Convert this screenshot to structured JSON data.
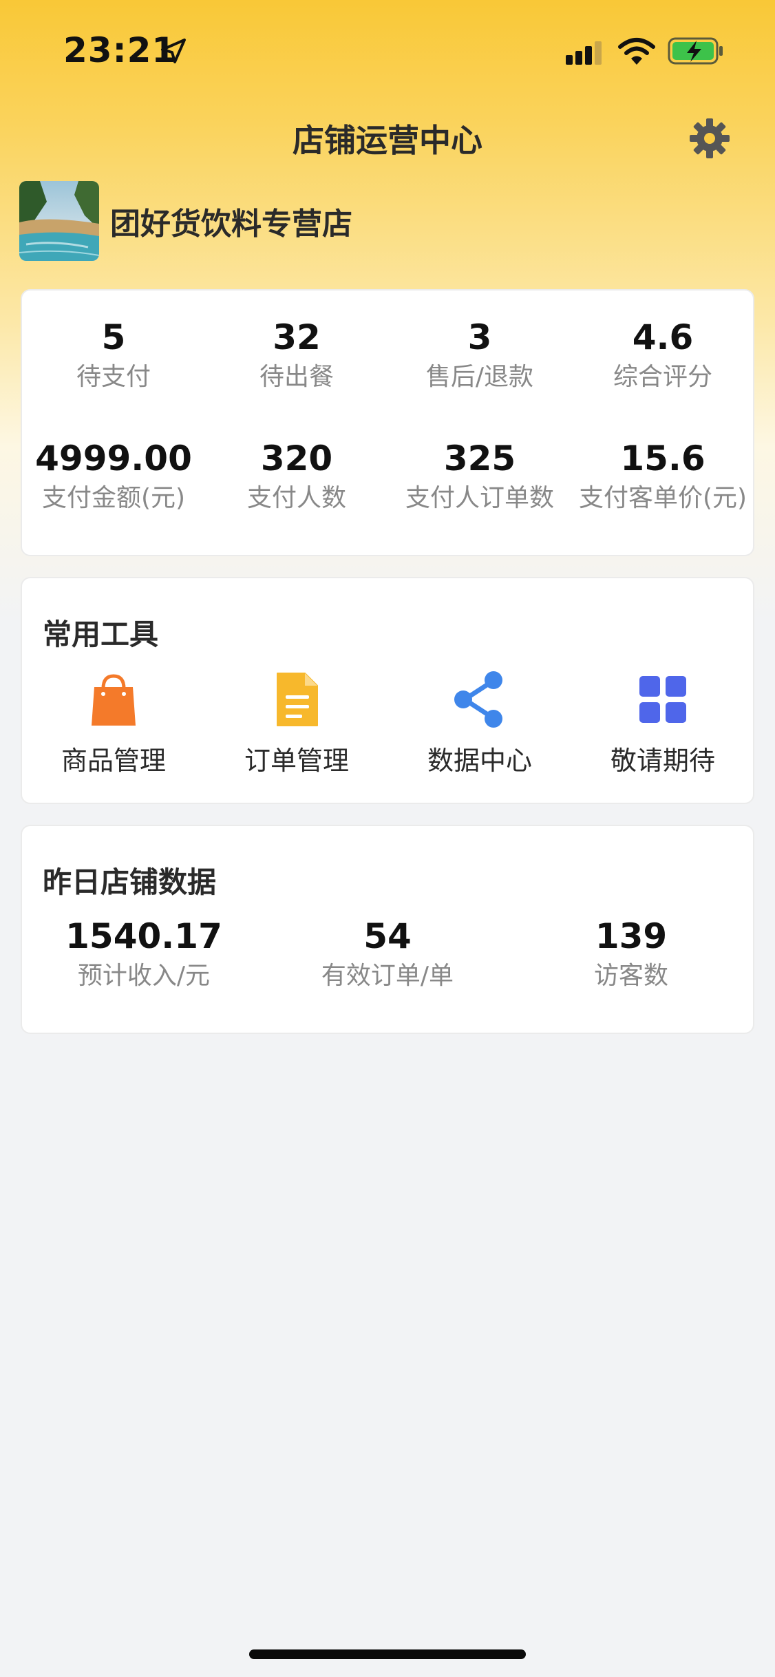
{
  "status_bar": {
    "time": "23:21"
  },
  "header": {
    "title": "店铺运营中心"
  },
  "store": {
    "name": "团好货饮料专营店"
  },
  "stats": [
    {
      "value": "5",
      "label": "待支付"
    },
    {
      "value": "32",
      "label": "待出餐"
    },
    {
      "value": "3",
      "label": "售后/退款"
    },
    {
      "value": "4.6",
      "label": "综合评分"
    },
    {
      "value": "4999.00",
      "label": "支付金额(元)"
    },
    {
      "value": "320",
      "label": "支付人数"
    },
    {
      "value": "325",
      "label": "支付人订单数"
    },
    {
      "value": "15.6",
      "label": "支付客单价(元)"
    }
  ],
  "tools": {
    "title": "常用工具",
    "items": [
      {
        "label": "商品管理",
        "icon": "shopping-bag-icon",
        "color": "#f47a2a"
      },
      {
        "label": "订单管理",
        "icon": "document-icon",
        "color": "#f7b82c"
      },
      {
        "label": "数据中心",
        "icon": "share-icon",
        "color": "#3f86ea"
      },
      {
        "label": "敬请期待",
        "icon": "grid-icon",
        "color": "#4f66ea"
      }
    ]
  },
  "yesterday": {
    "title": "昨日店铺数据",
    "items": [
      {
        "value": "1540.17",
        "label": "预计收入/元"
      },
      {
        "value": "54",
        "label": "有效订单/单"
      },
      {
        "value": "139",
        "label": "访客数"
      }
    ]
  },
  "colors": {
    "header_gradient_top": "#f9c837",
    "page_background": "#f2f3f5",
    "card_background": "#ffffff"
  }
}
